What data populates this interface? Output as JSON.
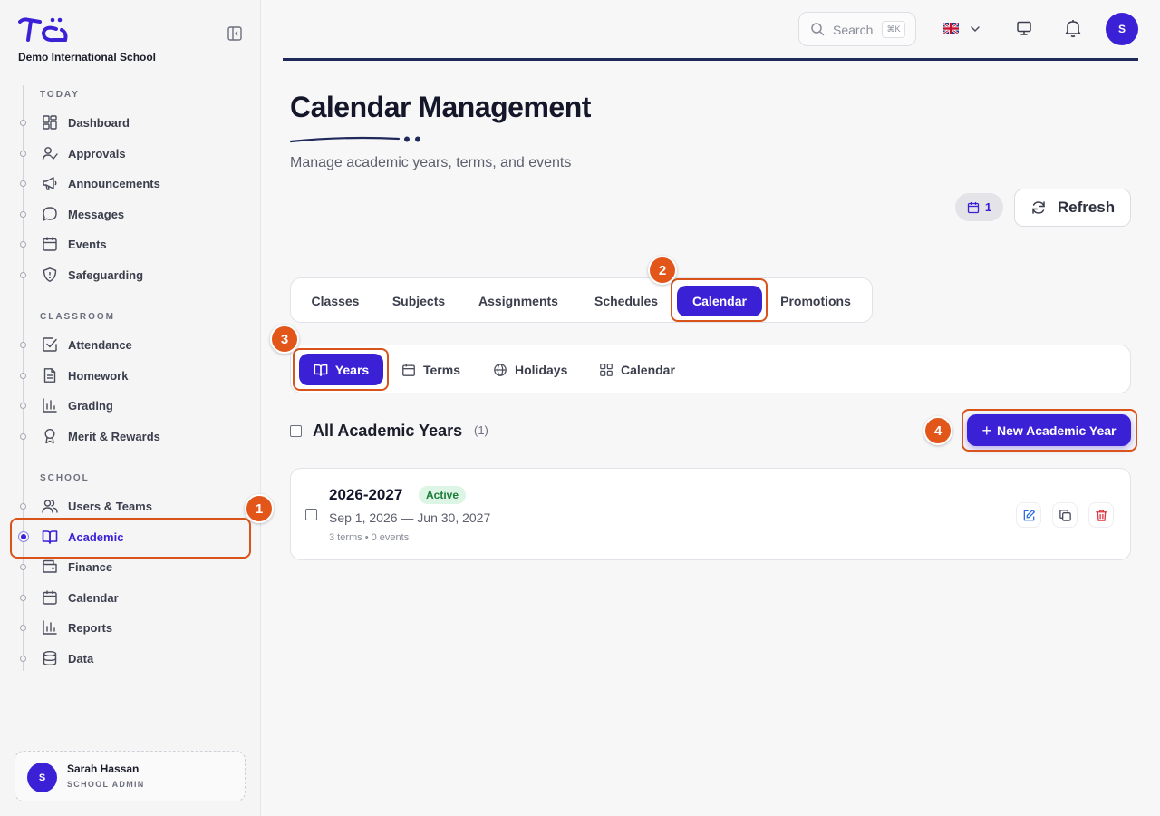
{
  "school": {
    "name": "Demo International School"
  },
  "sidebar": {
    "sections": [
      {
        "label": "TODAY",
        "items": [
          {
            "label": "Dashboard",
            "icon": "dashboard-icon"
          },
          {
            "label": "Approvals",
            "icon": "user-check-icon"
          },
          {
            "label": "Announcements",
            "icon": "megaphone-icon"
          },
          {
            "label": "Messages",
            "icon": "chat-bubble-icon"
          },
          {
            "label": "Events",
            "icon": "calendar-icon"
          },
          {
            "label": "Safeguarding",
            "icon": "shield-icon"
          }
        ]
      },
      {
        "label": "CLASSROOM",
        "items": [
          {
            "label": "Attendance",
            "icon": "check-square-icon"
          },
          {
            "label": "Homework",
            "icon": "document-icon"
          },
          {
            "label": "Grading",
            "icon": "bar-chart-icon"
          },
          {
            "label": "Merit & Rewards",
            "icon": "award-icon"
          }
        ]
      },
      {
        "label": "SCHOOL",
        "items": [
          {
            "label": "Users & Teams",
            "icon": "users-icon"
          },
          {
            "label": "Academic",
            "icon": "book-icon",
            "active": true
          },
          {
            "label": "Finance",
            "icon": "wallet-icon"
          },
          {
            "label": "Calendar",
            "icon": "calendar-icon"
          },
          {
            "label": "Reports",
            "icon": "bar-chart-icon"
          },
          {
            "label": "Data",
            "icon": "database-icon"
          }
        ]
      }
    ]
  },
  "user": {
    "initial": "S",
    "name": "Sarah Hassan",
    "role": "SCHOOL ADMIN"
  },
  "topbar": {
    "search_placeholder": "Search",
    "search_shortcut": "⌘K",
    "avatar_initial": "S"
  },
  "header": {
    "title": "Calendar Management",
    "subtitle": "Manage academic years, terms, and events",
    "count": "1",
    "refresh_label": "Refresh"
  },
  "tabs": [
    {
      "label": "Classes"
    },
    {
      "label": "Subjects"
    },
    {
      "label": "Assignments"
    },
    {
      "label": "Schedules"
    },
    {
      "label": "Calendar",
      "active": true
    },
    {
      "label": "Promotions"
    }
  ],
  "subtabs": [
    {
      "label": "Years",
      "icon": "book-icon",
      "active": true
    },
    {
      "label": "Terms",
      "icon": "calendar-icon"
    },
    {
      "label": "Holidays",
      "icon": "globe-icon"
    },
    {
      "label": "Calendar",
      "icon": "grid-icon"
    }
  ],
  "list": {
    "title": "All Academic Years",
    "count": "(1)",
    "new_button": "New Academic Year"
  },
  "years": [
    {
      "name": "2026-2027",
      "status": "Active",
      "dates": "Sep 1, 2026 — Jun 30, 2027",
      "meta": "3 terms • 0 events"
    }
  ],
  "annotations": [
    "1",
    "2",
    "3",
    "4"
  ],
  "colors": {
    "accent": "#3b21d6",
    "annotation": "#e2561a",
    "active_badge_bg": "#dcf5e4",
    "active_badge_text": "#1e7a3c"
  }
}
